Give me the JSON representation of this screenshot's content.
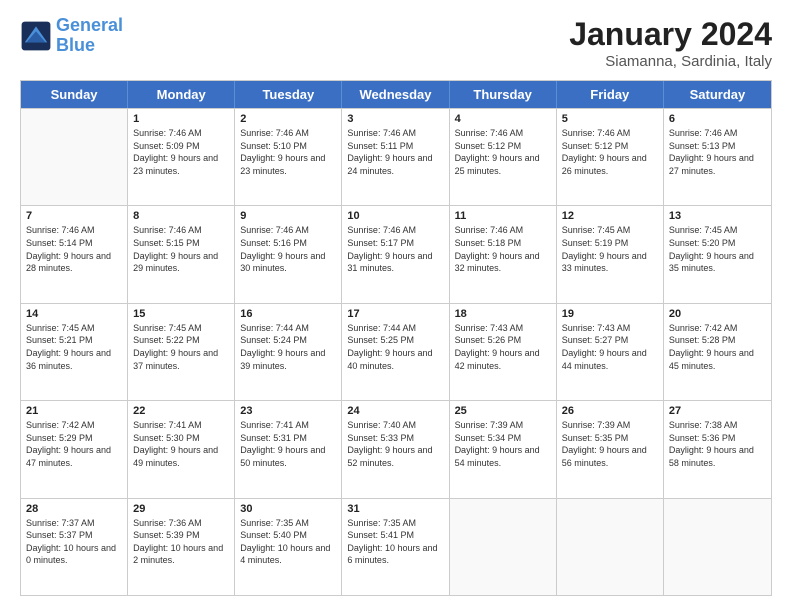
{
  "logo": {
    "text_general": "General",
    "text_blue": "Blue"
  },
  "header": {
    "month_year": "January 2024",
    "location": "Siamanna, Sardinia, Italy"
  },
  "day_headers": [
    "Sunday",
    "Monday",
    "Tuesday",
    "Wednesday",
    "Thursday",
    "Friday",
    "Saturday"
  ],
  "weeks": [
    [
      {
        "day": "",
        "empty": true
      },
      {
        "day": "1",
        "sunrise": "Sunrise: 7:46 AM",
        "sunset": "Sunset: 5:09 PM",
        "daylight": "Daylight: 9 hours and 23 minutes."
      },
      {
        "day": "2",
        "sunrise": "Sunrise: 7:46 AM",
        "sunset": "Sunset: 5:10 PM",
        "daylight": "Daylight: 9 hours and 23 minutes."
      },
      {
        "day": "3",
        "sunrise": "Sunrise: 7:46 AM",
        "sunset": "Sunset: 5:11 PM",
        "daylight": "Daylight: 9 hours and 24 minutes."
      },
      {
        "day": "4",
        "sunrise": "Sunrise: 7:46 AM",
        "sunset": "Sunset: 5:12 PM",
        "daylight": "Daylight: 9 hours and 25 minutes."
      },
      {
        "day": "5",
        "sunrise": "Sunrise: 7:46 AM",
        "sunset": "Sunset: 5:12 PM",
        "daylight": "Daylight: 9 hours and 26 minutes."
      },
      {
        "day": "6",
        "sunrise": "Sunrise: 7:46 AM",
        "sunset": "Sunset: 5:13 PM",
        "daylight": "Daylight: 9 hours and 27 minutes."
      }
    ],
    [
      {
        "day": "7",
        "sunrise": "Sunrise: 7:46 AM",
        "sunset": "Sunset: 5:14 PM",
        "daylight": "Daylight: 9 hours and 28 minutes."
      },
      {
        "day": "8",
        "sunrise": "Sunrise: 7:46 AM",
        "sunset": "Sunset: 5:15 PM",
        "daylight": "Daylight: 9 hours and 29 minutes."
      },
      {
        "day": "9",
        "sunrise": "Sunrise: 7:46 AM",
        "sunset": "Sunset: 5:16 PM",
        "daylight": "Daylight: 9 hours and 30 minutes."
      },
      {
        "day": "10",
        "sunrise": "Sunrise: 7:46 AM",
        "sunset": "Sunset: 5:17 PM",
        "daylight": "Daylight: 9 hours and 31 minutes."
      },
      {
        "day": "11",
        "sunrise": "Sunrise: 7:46 AM",
        "sunset": "Sunset: 5:18 PM",
        "daylight": "Daylight: 9 hours and 32 minutes."
      },
      {
        "day": "12",
        "sunrise": "Sunrise: 7:45 AM",
        "sunset": "Sunset: 5:19 PM",
        "daylight": "Daylight: 9 hours and 33 minutes."
      },
      {
        "day": "13",
        "sunrise": "Sunrise: 7:45 AM",
        "sunset": "Sunset: 5:20 PM",
        "daylight": "Daylight: 9 hours and 35 minutes."
      }
    ],
    [
      {
        "day": "14",
        "sunrise": "Sunrise: 7:45 AM",
        "sunset": "Sunset: 5:21 PM",
        "daylight": "Daylight: 9 hours and 36 minutes."
      },
      {
        "day": "15",
        "sunrise": "Sunrise: 7:45 AM",
        "sunset": "Sunset: 5:22 PM",
        "daylight": "Daylight: 9 hours and 37 minutes."
      },
      {
        "day": "16",
        "sunrise": "Sunrise: 7:44 AM",
        "sunset": "Sunset: 5:24 PM",
        "daylight": "Daylight: 9 hours and 39 minutes."
      },
      {
        "day": "17",
        "sunrise": "Sunrise: 7:44 AM",
        "sunset": "Sunset: 5:25 PM",
        "daylight": "Daylight: 9 hours and 40 minutes."
      },
      {
        "day": "18",
        "sunrise": "Sunrise: 7:43 AM",
        "sunset": "Sunset: 5:26 PM",
        "daylight": "Daylight: 9 hours and 42 minutes."
      },
      {
        "day": "19",
        "sunrise": "Sunrise: 7:43 AM",
        "sunset": "Sunset: 5:27 PM",
        "daylight": "Daylight: 9 hours and 44 minutes."
      },
      {
        "day": "20",
        "sunrise": "Sunrise: 7:42 AM",
        "sunset": "Sunset: 5:28 PM",
        "daylight": "Daylight: 9 hours and 45 minutes."
      }
    ],
    [
      {
        "day": "21",
        "sunrise": "Sunrise: 7:42 AM",
        "sunset": "Sunset: 5:29 PM",
        "daylight": "Daylight: 9 hours and 47 minutes."
      },
      {
        "day": "22",
        "sunrise": "Sunrise: 7:41 AM",
        "sunset": "Sunset: 5:30 PM",
        "daylight": "Daylight: 9 hours and 49 minutes."
      },
      {
        "day": "23",
        "sunrise": "Sunrise: 7:41 AM",
        "sunset": "Sunset: 5:31 PM",
        "daylight": "Daylight: 9 hours and 50 minutes."
      },
      {
        "day": "24",
        "sunrise": "Sunrise: 7:40 AM",
        "sunset": "Sunset: 5:33 PM",
        "daylight": "Daylight: 9 hours and 52 minutes."
      },
      {
        "day": "25",
        "sunrise": "Sunrise: 7:39 AM",
        "sunset": "Sunset: 5:34 PM",
        "daylight": "Daylight: 9 hours and 54 minutes."
      },
      {
        "day": "26",
        "sunrise": "Sunrise: 7:39 AM",
        "sunset": "Sunset: 5:35 PM",
        "daylight": "Daylight: 9 hours and 56 minutes."
      },
      {
        "day": "27",
        "sunrise": "Sunrise: 7:38 AM",
        "sunset": "Sunset: 5:36 PM",
        "daylight": "Daylight: 9 hours and 58 minutes."
      }
    ],
    [
      {
        "day": "28",
        "sunrise": "Sunrise: 7:37 AM",
        "sunset": "Sunset: 5:37 PM",
        "daylight": "Daylight: 10 hours and 0 minutes."
      },
      {
        "day": "29",
        "sunrise": "Sunrise: 7:36 AM",
        "sunset": "Sunset: 5:39 PM",
        "daylight": "Daylight: 10 hours and 2 minutes."
      },
      {
        "day": "30",
        "sunrise": "Sunrise: 7:35 AM",
        "sunset": "Sunset: 5:40 PM",
        "daylight": "Daylight: 10 hours and 4 minutes."
      },
      {
        "day": "31",
        "sunrise": "Sunrise: 7:35 AM",
        "sunset": "Sunset: 5:41 PM",
        "daylight": "Daylight: 10 hours and 6 minutes."
      },
      {
        "day": "",
        "empty": true
      },
      {
        "day": "",
        "empty": true
      },
      {
        "day": "",
        "empty": true
      }
    ]
  ]
}
